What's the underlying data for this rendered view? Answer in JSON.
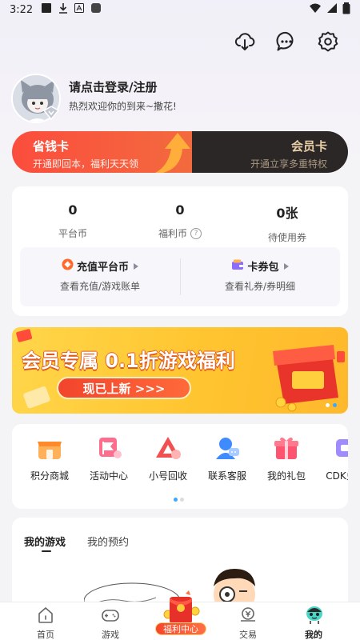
{
  "status_bar": {
    "time": "3:22"
  },
  "profile": {
    "login_prompt": "请点击登录/注册",
    "welcome": "热烈欢迎你的到来~撒花!"
  },
  "membership_banner": {
    "left_title": "省钱卡",
    "left_sub": "开通即回本，福利天天领",
    "right_title": "会员卡",
    "right_sub": "开通立享多重特权"
  },
  "assets": {
    "stats": [
      {
        "value": "0",
        "label": "平台币"
      },
      {
        "value": "0",
        "label": "福利币"
      },
      {
        "value": "0张",
        "label": "待使用券"
      }
    ],
    "recharge": {
      "title": "充值平台币",
      "sub": "查看充值/游戏账单"
    },
    "coupons": {
      "title": "卡券包",
      "sub": "查看礼券/券明细"
    }
  },
  "promo": {
    "title": "会员专属 0.1折游戏福利",
    "button": "现已上新 >>>"
  },
  "services": [
    {
      "label": "积分商城",
      "icon": "shop-icon",
      "color": "#ff9b3d"
    },
    {
      "label": "活动中心",
      "icon": "flag-icon",
      "color": "#ff5b7e"
    },
    {
      "label": "小号回收",
      "icon": "recycle-icon",
      "color": "#f04d4d"
    },
    {
      "label": "联系客服",
      "icon": "customer-service-icon",
      "color": "#3d8bff"
    },
    {
      "label": "我的礼包",
      "icon": "gift-icon",
      "color": "#ff4f6a"
    },
    {
      "label": "CDK兑换",
      "icon": "cdk-icon",
      "color": "#8c7bff"
    }
  ],
  "games_tabs": [
    {
      "label": "我的游戏"
    },
    {
      "label": "我的预约"
    }
  ],
  "bottom_nav": [
    {
      "label": "首页"
    },
    {
      "label": "游戏"
    },
    {
      "label": "福利中心"
    },
    {
      "label": "交易"
    },
    {
      "label": "我的"
    }
  ]
}
